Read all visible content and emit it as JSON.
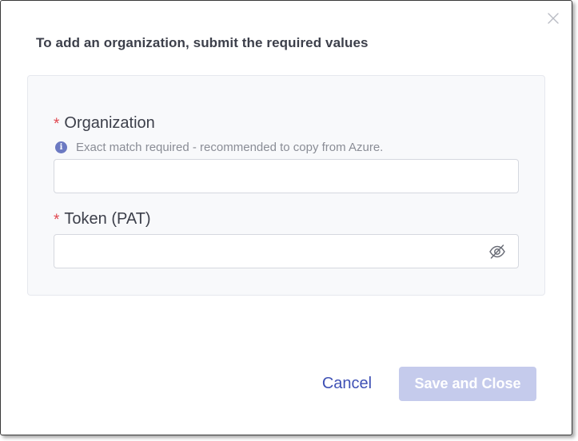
{
  "dialog": {
    "title": "To add an organization, submit the required values",
    "close_icon": "close-icon"
  },
  "form": {
    "organization": {
      "required_marker": "*",
      "label": "Organization",
      "hint": "Exact match required - recommended to copy from Azure.",
      "hint_icon": "info-icon",
      "value": "",
      "placeholder": ""
    },
    "token": {
      "required_marker": "*",
      "label": "Token (PAT)",
      "value": "",
      "placeholder": "",
      "visibility_icon": "eye-slash-icon"
    }
  },
  "actions": {
    "cancel_label": "Cancel",
    "save_label": "Save and Close",
    "save_enabled": false
  },
  "colors": {
    "accent": "#3f51b5",
    "save_disabled_bg": "#c5cbec",
    "required": "#e0474f",
    "info": "#6c7ac2"
  }
}
